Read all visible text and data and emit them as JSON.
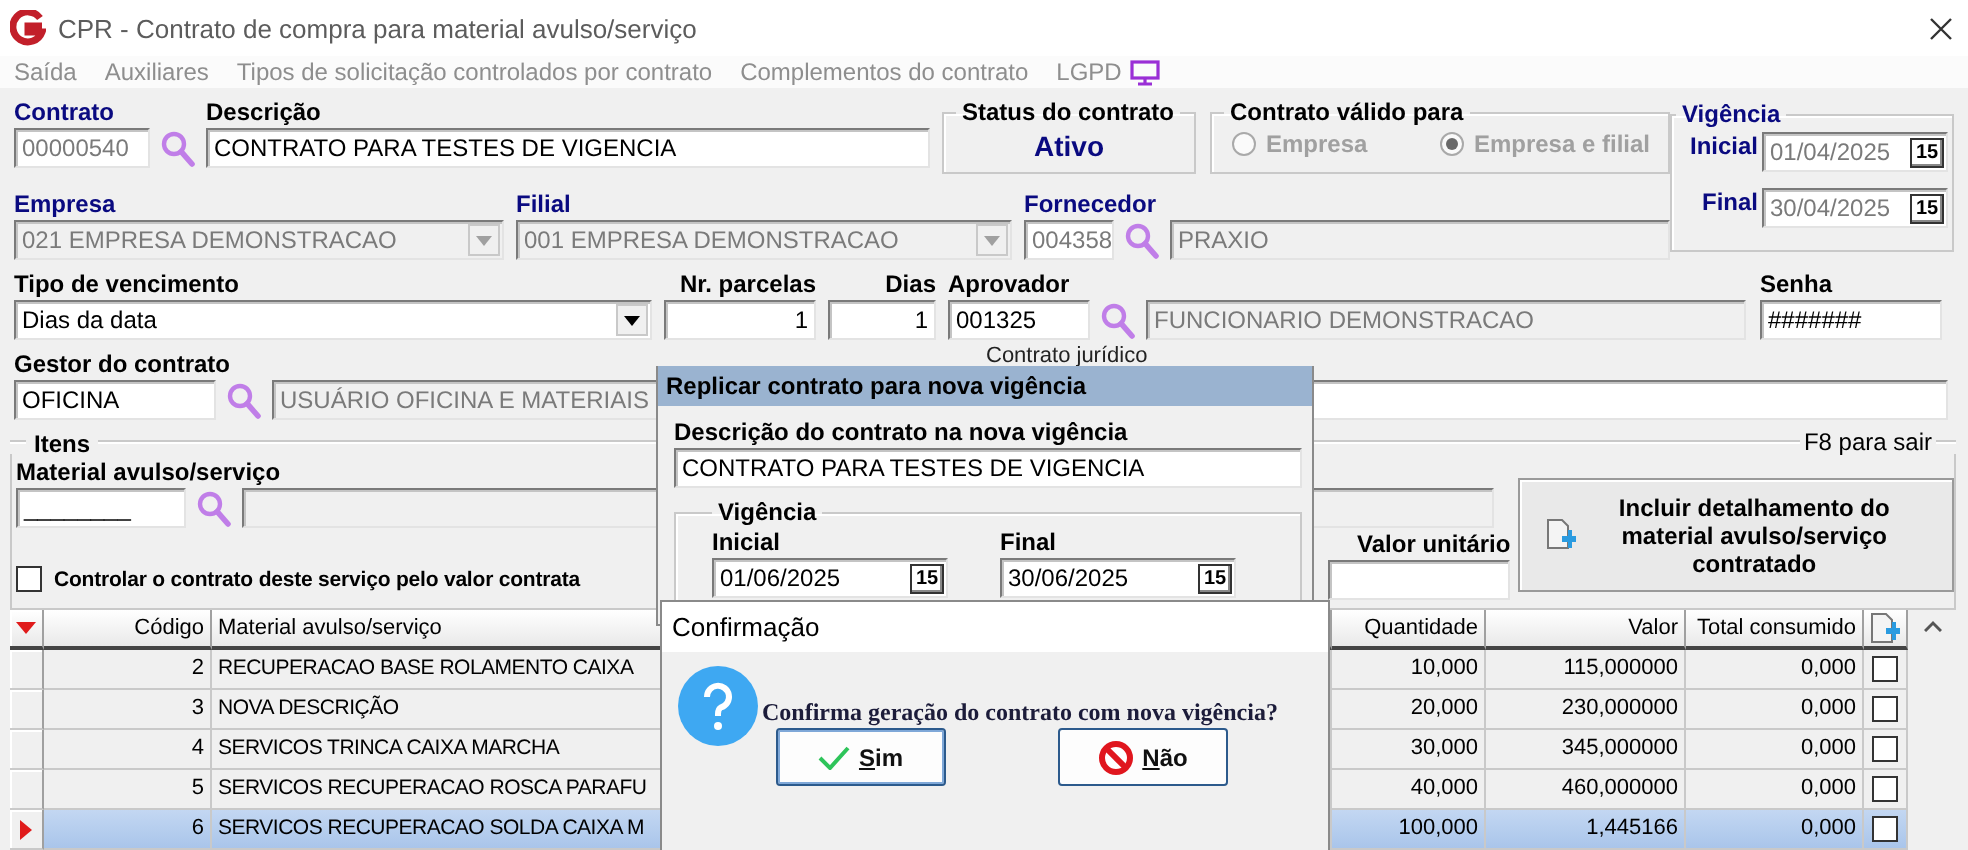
{
  "window": {
    "title": "CPR - Contrato de compra para material avulso/serviço"
  },
  "menu": [
    {
      "label": "Saída",
      "disabled": true
    },
    {
      "label": "Auxiliares",
      "disabled": true
    },
    {
      "label": "Tipos de solicitação controlados por contrato",
      "disabled": true
    },
    {
      "label": "Complementos do contrato",
      "disabled": true
    },
    {
      "label": "LGPD",
      "disabled": true
    }
  ],
  "contract": {
    "contrato": {
      "label": "Contrato",
      "value": "00000540",
      "required": true,
      "disabled": true
    },
    "descricao": {
      "label": "Descrição",
      "value": "CONTRATO PARA TESTES DE VIGENCIA",
      "required": false,
      "disabled": false
    },
    "status": {
      "label": "Status do contrato",
      "value": "Ativo"
    },
    "valid_for": {
      "label": "Contrato válido para",
      "disabled": true,
      "options": [
        {
          "label": "Empresa",
          "selected": false
        },
        {
          "label": "Empresa e filial",
          "selected": true
        }
      ]
    },
    "vigencia": {
      "label": "Vigência",
      "required": true,
      "start": {
        "label": "Inicial",
        "value": "01/04/2025",
        "picker": "15",
        "disabled": true
      },
      "end": {
        "label": "Final",
        "value": "30/04/2025",
        "picker": "15",
        "disabled": true
      }
    },
    "empresa": {
      "label": "Empresa",
      "value": "021 EMPRESA DEMONSTRACAO",
      "required": true,
      "disabled": true
    },
    "filial": {
      "label": "Filial",
      "value": "001 EMPRESA DEMONSTRACAO",
      "required": true,
      "disabled": true
    },
    "fornecedor": {
      "label": "Fornecedor",
      "code": "004358",
      "name": "PRAXIO",
      "required": true,
      "disabled": true
    },
    "tipo_vencimento": {
      "label": "Tipo de vencimento",
      "value": "Dias da data",
      "required": false,
      "disabled": false
    },
    "nr_parcelas": {
      "label": "Nr. parcelas",
      "value": "1"
    },
    "dias": {
      "label": "Dias",
      "value": "1"
    },
    "aprovador": {
      "label": "Aprovador",
      "code": "001325",
      "name": "FUNCIONARIO DEMONSTRACAO",
      "required": false,
      "disabled": false
    },
    "senha": {
      "label": "Senha",
      "value": "#######"
    },
    "gestor": {
      "label": "Gestor do contrato",
      "code": "OFICINA",
      "name": "USUÁRIO OFICINA E MATERIAIS",
      "required": false,
      "disabled": false
    },
    "contrato_juridico": {
      "label": "Contrato jurídico"
    }
  },
  "items": {
    "title": "Itens",
    "hint": "F8 para sair",
    "material": {
      "label": "Material avulso/serviço",
      "value": "________"
    },
    "control_by_value": {
      "label": "Controlar o contrato deste serviço pelo valor contrata",
      "checked": false
    },
    "valor_unitario": {
      "label": "Valor unitário"
    },
    "include_button": "Incluir detalhamento do material avulso/serviço contratado"
  },
  "table": {
    "columns": [
      "Código",
      "Material avulso/serviço",
      "Quantidade",
      "Valor",
      "Total consumido"
    ],
    "rows": [
      {
        "codigo": "2",
        "material": "RECUPERACAO BASE ROLAMENTO CAIXA",
        "quantidade": "10,000",
        "valor": "115,000000",
        "total_consumido": "0,000",
        "checked": false,
        "selected": false
      },
      {
        "codigo": "3",
        "material": "NOVA DESCRIÇÃO",
        "quantidade": "20,000",
        "valor": "230,000000",
        "total_consumido": "0,000",
        "checked": false,
        "selected": false
      },
      {
        "codigo": "4",
        "material": "SERVICOS TRINCA CAIXA MARCHA",
        "quantidade": "30,000",
        "valor": "345,000000",
        "total_consumido": "0,000",
        "checked": false,
        "selected": false
      },
      {
        "codigo": "5",
        "material": "SERVICOS RECUPERACAO ROSCA PARAFU",
        "quantidade": "40,000",
        "valor": "460,000000",
        "total_consumido": "0,000",
        "checked": false,
        "selected": false
      },
      {
        "codigo": "6",
        "material": "SERVICOS RECUPERACAO SOLDA CAIXA M",
        "quantidade": "100,000",
        "valor": "1,445166",
        "total_consumido": "0,000",
        "checked": false,
        "selected": true
      }
    ]
  },
  "replicate_dialog": {
    "title": "Replicar contrato para nova vigência",
    "description": {
      "label": "Descrição do contrato na nova vigência",
      "value": "CONTRATO PARA TESTES DE VIGENCIA"
    },
    "vigencia": {
      "label": "Vigência",
      "start": {
        "label": "Inicial",
        "value": "01/06/2025",
        "picker": "15"
      },
      "end": {
        "label": "Final",
        "value": "30/06/2025",
        "picker": "15"
      }
    }
  },
  "confirm_dialog": {
    "title": "Confirmação",
    "message": "Confirma geração do contrato com nova vigência?",
    "buttons": [
      {
        "label": "Sim",
        "kind": "yes"
      },
      {
        "label": "Não",
        "kind": "no"
      }
    ]
  }
}
